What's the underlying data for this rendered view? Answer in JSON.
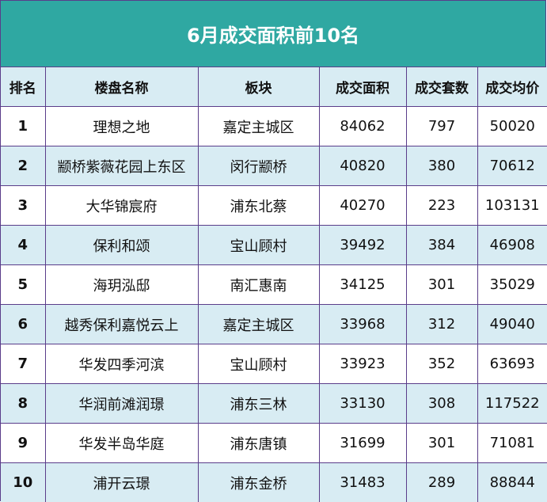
{
  "chart_data": {
    "type": "table",
    "title": "6月成交面积前10名",
    "columns": [
      "排名",
      "楼盘名称",
      "板块",
      "成交面积",
      "成交套数",
      "成交均价"
    ],
    "rows": [
      [
        "1",
        "理想之地",
        "嘉定主城区",
        "84062",
        "797",
        "50020"
      ],
      [
        "2",
        "颛桥紫薇花园上东区",
        "闵行颛桥",
        "40820",
        "380",
        "70612"
      ],
      [
        "3",
        "大华锦宸府",
        "浦东北蔡",
        "40270",
        "223",
        "103131"
      ],
      [
        "4",
        "保利和颂",
        "宝山顾村",
        "39492",
        "384",
        "46908"
      ],
      [
        "5",
        "海玥泓邸",
        "南汇惠南",
        "34125",
        "301",
        "35029"
      ],
      [
        "6",
        "越秀保利嘉悦云上",
        "嘉定主城区",
        "33968",
        "312",
        "49040"
      ],
      [
        "7",
        "华发四季河滨",
        "宝山顾村",
        "33923",
        "352",
        "63693"
      ],
      [
        "8",
        "华润前滩润璟",
        "浦东三林",
        "33130",
        "308",
        "117522"
      ],
      [
        "9",
        "华发半岛华庭",
        "浦东唐镇",
        "31699",
        "301",
        "71081"
      ],
      [
        "10",
        "浦开云璟",
        "浦东金桥",
        "31483",
        "289",
        "88844"
      ]
    ]
  },
  "colors": {
    "title_bg": "#2fa8a2",
    "header_bg": "#d8ecf3",
    "border": "#5a3d8a"
  }
}
